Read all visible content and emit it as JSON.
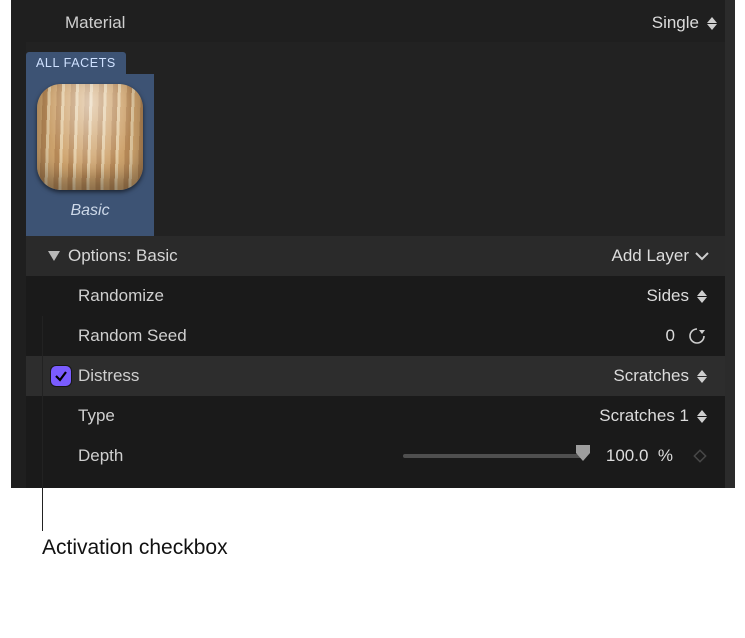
{
  "material": {
    "label": "Material",
    "value": "Single"
  },
  "facets": {
    "tab_label": "ALL FACETS",
    "swatch_name": "Basic"
  },
  "options": {
    "header_label": "Options: Basic",
    "add_layer_label": "Add Layer"
  },
  "params": {
    "randomize": {
      "label": "Randomize",
      "value": "Sides"
    },
    "random_seed": {
      "label": "Random Seed",
      "value": "0"
    },
    "distress": {
      "label": "Distress",
      "value": "Scratches",
      "checked": true
    },
    "type": {
      "label": "Type",
      "value": "Scratches 1"
    },
    "depth": {
      "label": "Depth",
      "value": "100.0",
      "unit": "%"
    }
  },
  "callout": {
    "text": "Activation checkbox"
  }
}
